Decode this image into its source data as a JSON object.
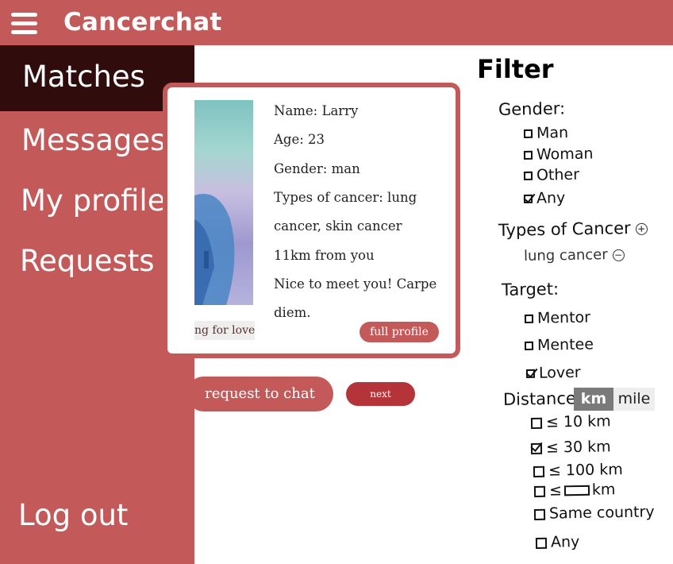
{
  "app": {
    "title": "Cancerchat",
    "menu_icon": "hamburger-menu-icon"
  },
  "sidebar": {
    "items": [
      {
        "label": "Matches",
        "active": true
      },
      {
        "label": "Messages"
      },
      {
        "label": "My profile"
      },
      {
        "label": "Requests"
      }
    ],
    "logout_label": "Log out"
  },
  "card": {
    "image_caption": "ng for love",
    "lines": [
      "Name: Larry",
      "Age: 23",
      "Gender: man",
      "Types of cancer: lung",
      "cancer, skin cancer",
      "11km from you",
      "Nice to meet you! Carpe",
      "diem."
    ],
    "full_profile_label": "full profile"
  },
  "actions": {
    "request_label": "request to chat",
    "next_label": "next"
  },
  "filter": {
    "title": "Filter",
    "gender": {
      "label": "Gender:",
      "options": [
        {
          "label": "Man",
          "checked": false
        },
        {
          "label": "Woman",
          "checked": false
        },
        {
          "label": "Other",
          "checked": false
        },
        {
          "label": "Any",
          "checked": true
        }
      ]
    },
    "cancer_types": {
      "label": "Types of Cancer",
      "selected": "lung cancer"
    },
    "target": {
      "label": "Target:",
      "options": [
        {
          "label": "Mentor",
          "checked": false
        },
        {
          "label": "Mentee",
          "checked": false
        },
        {
          "label": "Lover",
          "checked": true
        }
      ]
    },
    "distance": {
      "label": "Distance",
      "unit_km": "km",
      "unit_mile": "mile",
      "selected_unit": "km",
      "options": [
        {
          "label": "≤ 10 km",
          "checked": false
        },
        {
          "label": "≤ 30 km",
          "checked": true
        },
        {
          "label": "≤ 100 km",
          "checked": false
        },
        {
          "label_prefix": "≤",
          "label_suffix": "km",
          "checked": false
        },
        {
          "label": "Same country",
          "checked": false
        },
        {
          "label": "Any",
          "checked": false
        }
      ]
    }
  },
  "colors": {
    "brand": "#c4595a",
    "active_nav": "#300c0c",
    "next_button": "#b4343a"
  }
}
